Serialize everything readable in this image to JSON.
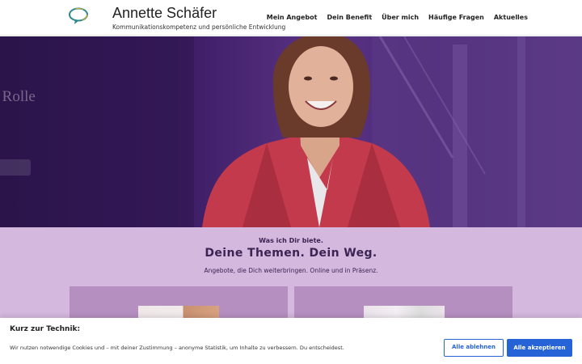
{
  "header": {
    "title": "Annette Schäfer",
    "tagline": "Kommunikationskompetenz und persönliche Entwicklung",
    "logo_icon": "speech-bubble-icon",
    "nav": [
      {
        "label": "Mein Angebot"
      },
      {
        "label": "Dein Benefit"
      },
      {
        "label": "Über mich"
      },
      {
        "label": "Häufige Fragen"
      },
      {
        "label": "Aktuelles"
      }
    ]
  },
  "hero": {
    "partial_headline": "en Rolle"
  },
  "offers": {
    "kicker": "Was ich Dir biete.",
    "heading": "Deine Themen. Dein Weg.",
    "subline": "Angebote, die Dich weiterbringen. Online und in Präsenz."
  },
  "cookie_banner": {
    "title": "Kurz zur Technik:",
    "text": "Wir nutzen notwendige Cookies und – mit deiner Zustimmung – anonyme Statistik, um Inhalte zu verbessern. Du entscheidest.",
    "reject_label": "Alle ablehnen",
    "accept_label": "Alle akzeptieren"
  },
  "colors": {
    "accent_purple": "#3b2454",
    "section_bg": "#d4b8dd",
    "card_bg": "#b58fc0",
    "button_blue": "#2563d6"
  }
}
